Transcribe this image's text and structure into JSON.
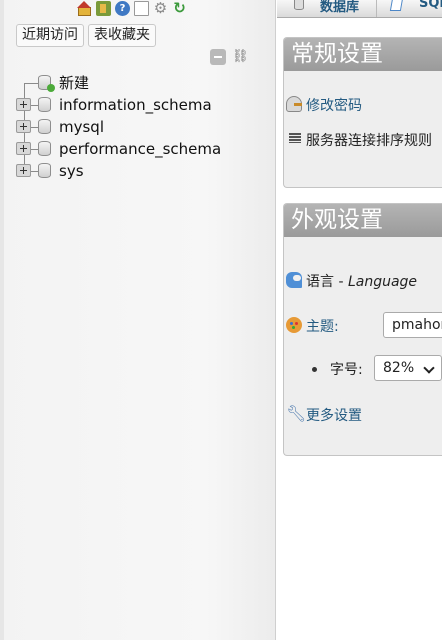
{
  "nav": {
    "tabs": [
      "近期访问",
      "表收藏夹"
    ],
    "tree": [
      {
        "label": "新建",
        "new": true
      },
      {
        "label": "information_schema"
      },
      {
        "label": "mysql"
      },
      {
        "label": "performance_schema"
      },
      {
        "label": "sys"
      }
    ]
  },
  "topbar": {
    "tab_databases": "数据库",
    "tab_sql": "SQL"
  },
  "general": {
    "title": "常规设置",
    "change_password": "修改密码",
    "server_collation": "服务器连接排序规则"
  },
  "appearance": {
    "title": "外观设置",
    "language_label": "语言 - ",
    "language_value": "Language",
    "theme_label": "主题:",
    "theme_value": "pmahomme",
    "font_label": "字号:",
    "font_value": "82%",
    "more_settings": "更多设置"
  },
  "icons": {
    "nav_top": [
      "home-icon",
      "logout-icon",
      "help-icon",
      "docs-icon",
      "settings-icon",
      "reload-icon"
    ],
    "tree_expander": "plus-box-icon",
    "tree_node": "database-icon"
  },
  "colors": {
    "panel_header": "#a7a7a7",
    "link": "#235a81",
    "nav_bg": "#f5f5f5"
  }
}
